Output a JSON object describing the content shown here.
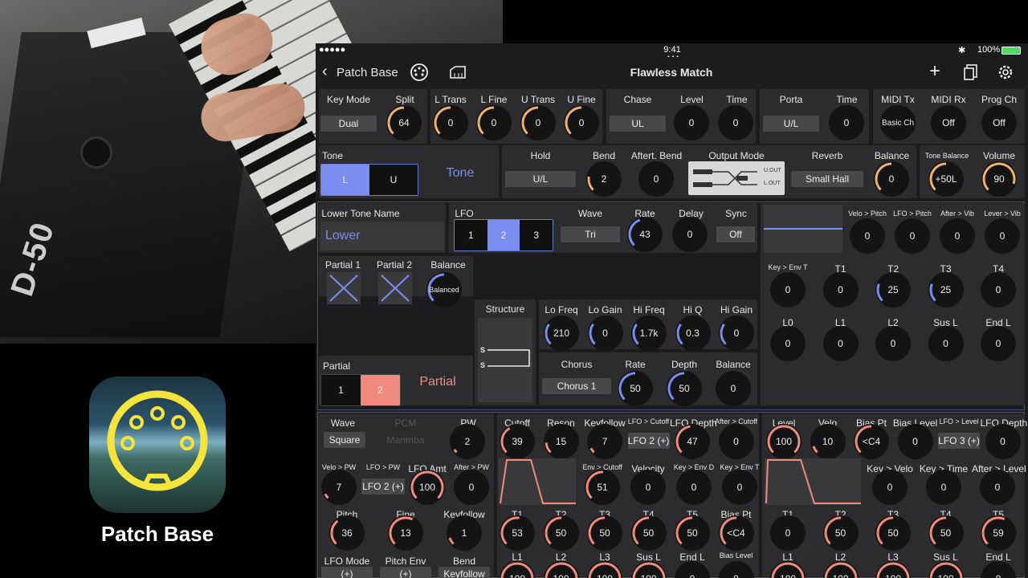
{
  "status": {
    "carrier": "●●●●● ",
    "time": "9:41 AM",
    "battery": "100%"
  },
  "nav": {
    "back_label": "Patch Base",
    "title": "Flawless Match"
  },
  "logo": {
    "caption": "Patch Base"
  },
  "colors": {
    "blue": "#7b8cf0",
    "red": "#f08a7c",
    "orange": "#f0b070"
  },
  "common": {
    "key_mode": {
      "label": "Key Mode",
      "value": "Dual"
    },
    "split": {
      "label": "Split",
      "value": "64"
    },
    "l_trans": {
      "label": "L Trans",
      "value": "0"
    },
    "l_fine": {
      "label": "L Fine",
      "value": "0"
    },
    "u_trans": {
      "label": "U Trans",
      "value": "0"
    },
    "u_fine": {
      "label": "U Fine",
      "value": "0"
    },
    "chase": {
      "label": "Chase",
      "value": "UL"
    },
    "level": {
      "label": "Level",
      "value": "0"
    },
    "time": {
      "label": "Time",
      "value": "0"
    },
    "porta": {
      "label": "Porta",
      "value": "U/L"
    },
    "porta_time": {
      "label": "Time",
      "value": "0"
    },
    "midi_tx": {
      "label": "MIDI Tx",
      "value": "Basic Ch"
    },
    "midi_rx": {
      "label": "MIDI Rx",
      "value": "Off"
    },
    "prog_ch": {
      "label": "Prog Ch",
      "value": "Off"
    },
    "tone_label": "Tone",
    "tone_seg": [
      "L",
      "U"
    ],
    "tone_title": "Tone",
    "hold": {
      "label": "Hold",
      "value": "U/L"
    },
    "bend": {
      "label": "Bend",
      "value": "2"
    },
    "after_bend": {
      "label": "Aftert. Bend",
      "value": "0"
    },
    "output_mode": {
      "label": "Output Mode",
      "u_out": "U.OUT",
      "l_out": "L.OUT"
    },
    "reverb": {
      "label": "Reverb",
      "value": "Small Hall"
    },
    "balance": {
      "label": "Balance",
      "value": "0"
    },
    "tone_balance": {
      "label": "Tone Balance",
      "value": "+50L"
    },
    "volume": {
      "label": "Volume",
      "value": "90"
    }
  },
  "tone": {
    "name_label": "Lower Tone Name",
    "name": "Lower",
    "lfo_label": "LFO",
    "lfo_seg": [
      "1",
      "2",
      "3"
    ],
    "wave": {
      "label": "Wave",
      "value": "Tri"
    },
    "rate": {
      "label": "Rate",
      "value": "43"
    },
    "delay": {
      "label": "Delay",
      "value": "0"
    },
    "sync": {
      "label": "Sync",
      "value": "Off"
    },
    "partial1_label": "Partial 1",
    "partial2_label": "Partial 2",
    "pbalance": {
      "label": "Balance",
      "value": "Balanced"
    },
    "structure_label": "Structure",
    "s1": "S",
    "s2": "S",
    "partial_label": "Partial",
    "partial_seg": [
      "1",
      "2"
    ],
    "partial_title": "Partial",
    "eq": [
      {
        "label": "Lo Freq",
        "value": "210"
      },
      {
        "label": "Lo Gain",
        "value": "0"
      },
      {
        "label": "Hi Freq",
        "value": "1.7k"
      },
      {
        "label": "Hi Q",
        "value": "0.3"
      },
      {
        "label": "Hi Gain",
        "value": "0"
      }
    ],
    "chorus": {
      "label": "Chorus",
      "value": "Chorus 1"
    },
    "chorus_knobs": [
      {
        "label": "Rate",
        "value": "50"
      },
      {
        "label": "Depth",
        "value": "50"
      },
      {
        "label": "Balance",
        "value": "0"
      }
    ],
    "pitch_env_top": [
      {
        "label": "Velo > Pitch",
        "value": "0"
      },
      {
        "label": "LFO > Pitch",
        "value": "0"
      },
      {
        "label": "After > Vib",
        "value": "0"
      },
      {
        "label": "Lever > Vib",
        "value": "0"
      }
    ],
    "pitch_env_t": [
      {
        "label": "Key > Env T",
        "value": "0"
      },
      {
        "label": "T1",
        "value": "0"
      },
      {
        "label": "T2",
        "value": "25"
      },
      {
        "label": "T3",
        "value": "25"
      },
      {
        "label": "T4",
        "value": "0"
      }
    ],
    "pitch_env_l": [
      {
        "label": "L0",
        "value": "0"
      },
      {
        "label": "L1",
        "value": "0"
      },
      {
        "label": "L2",
        "value": "0"
      },
      {
        "label": "Sus L",
        "value": "0"
      },
      {
        "label": "End L",
        "value": "0"
      }
    ]
  },
  "partial": {
    "wave": {
      "label": "Wave",
      "value": "Square"
    },
    "pcm": {
      "label": "PCM",
      "value": "Marimba"
    },
    "pw": {
      "label": "PW",
      "value": "2"
    },
    "row2": [
      {
        "label": "Velo > PW",
        "value": "7"
      },
      {
        "label": "LFO > PW",
        "value": "LFO 2 (+)"
      },
      {
        "label": "LFO Amt",
        "value": "100"
      },
      {
        "label": "After > PW",
        "value": "0"
      }
    ],
    "row3": [
      {
        "label": "Pitch",
        "value": "36"
      },
      {
        "label": "Fine",
        "value": "13"
      },
      {
        "label": "Keyfollow",
        "value": "1"
      }
    ],
    "row4": [
      {
        "label": "LFO Mode",
        "value": "(+)"
      },
      {
        "label": "Pitch Env",
        "value": "(+)"
      },
      {
        "label": "Bend",
        "value": "Keyfollow"
      }
    ],
    "tvf_row1": [
      {
        "label": "Cutoff",
        "value": "39"
      },
      {
        "label": "Reson",
        "value": "15"
      },
      {
        "label": "Keyfollow",
        "value": "7"
      },
      {
        "label": "LFO > Cutoff",
        "value": "LFO 2 (+)"
      },
      {
        "label": "LFO Depth",
        "value": "47"
      },
      {
        "label": "After > Cutoff",
        "value": "0"
      }
    ],
    "tvf_row2": [
      {
        "label": "Env > Cutoff",
        "value": "51"
      },
      {
        "label": "Velocity",
        "value": "0"
      },
      {
        "label": "Key > Env D",
        "value": "0"
      },
      {
        "label": "Key > Env T",
        "value": "0"
      }
    ],
    "tvf_t": [
      {
        "label": "T1",
        "value": "53"
      },
      {
        "label": "T2",
        "value": "50"
      },
      {
        "label": "T3",
        "value": "50"
      },
      {
        "label": "T4",
        "value": "50"
      },
      {
        "label": "T5",
        "value": "50"
      },
      {
        "label": "Bias Pt",
        "value": "<C4"
      }
    ],
    "tvf_l": [
      {
        "label": "L1",
        "value": "100"
      },
      {
        "label": "L2",
        "value": "100"
      },
      {
        "label": "L3",
        "value": "100"
      },
      {
        "label": "Sus L",
        "value": "100"
      },
      {
        "label": "End L",
        "value": "0"
      },
      {
        "label": "Bias Level",
        "value": "0"
      }
    ],
    "tva_row1": [
      {
        "label": "Level",
        "value": "100"
      },
      {
        "label": "Velo",
        "value": "10"
      },
      {
        "label": "Bias Pt",
        "value": "<C4"
      },
      {
        "label": "Bias Level",
        "value": "0"
      },
      {
        "label": "LFO > Level",
        "value": "LFO 3 (+)"
      },
      {
        "label": "LFO Depth",
        "value": "0"
      }
    ],
    "tva_row2": [
      {
        "label": "Key > Velo",
        "value": "0"
      },
      {
        "label": "Key > Time",
        "value": "0"
      },
      {
        "label": "After > Level",
        "value": "0"
      }
    ],
    "tva_t": [
      {
        "label": "T1",
        "value": "0"
      },
      {
        "label": "T2",
        "value": "50"
      },
      {
        "label": "T3",
        "value": "50"
      },
      {
        "label": "T4",
        "value": "50"
      },
      {
        "label": "T5",
        "value": "59"
      }
    ],
    "tva_l": [
      {
        "label": "L1",
        "value": "100"
      },
      {
        "label": "L2",
        "value": "100"
      },
      {
        "label": "L3",
        "value": "100"
      },
      {
        "label": "Sus L",
        "value": "100"
      },
      {
        "label": "End L",
        "value": "0"
      }
    ]
  }
}
